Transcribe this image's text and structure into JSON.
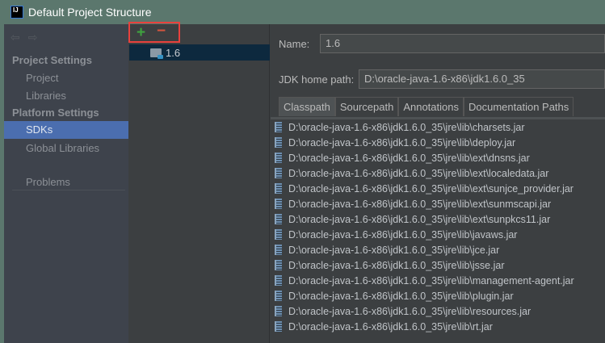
{
  "window": {
    "title": "Default Project Structure",
    "icon": "intellij-icon",
    "icon_text": "IJ"
  },
  "sidebar": {
    "nav": [
      "back-arrow-icon",
      "forward-arrow-icon"
    ],
    "sections": [
      {
        "label": "Project Settings"
      },
      {
        "label": "Platform Settings"
      }
    ],
    "items": [
      {
        "label": "Project"
      },
      {
        "label": "Libraries"
      },
      {
        "label": "SDKs",
        "selected": true
      },
      {
        "label": "Global Libraries"
      },
      {
        "label": "Problems"
      }
    ]
  },
  "toolbar": {
    "add": "+",
    "remove": "−",
    "highlight_color": "#e8413d"
  },
  "sdk_list": [
    {
      "label": "1.6"
    }
  ],
  "details": {
    "name_label": "Name:",
    "name_value": "1.6",
    "home_label": "JDK home path:",
    "home_value": "D:\\oracle-java-1.6-x86\\jdk1.6.0_35",
    "tabs": [
      {
        "label": "Classpath",
        "active": true
      },
      {
        "label": "Sourcepath"
      },
      {
        "label": "Annotations"
      },
      {
        "label": "Documentation Paths"
      }
    ],
    "classpath": [
      "D:\\oracle-java-1.6-x86\\jdk1.6.0_35\\jre\\lib\\charsets.jar",
      "D:\\oracle-java-1.6-x86\\jdk1.6.0_35\\jre\\lib\\deploy.jar",
      "D:\\oracle-java-1.6-x86\\jdk1.6.0_35\\jre\\lib\\ext\\dnsns.jar",
      "D:\\oracle-java-1.6-x86\\jdk1.6.0_35\\jre\\lib\\ext\\localedata.jar",
      "D:\\oracle-java-1.6-x86\\jdk1.6.0_35\\jre\\lib\\ext\\sunjce_provider.jar",
      "D:\\oracle-java-1.6-x86\\jdk1.6.0_35\\jre\\lib\\ext\\sunmscapi.jar",
      "D:\\oracle-java-1.6-x86\\jdk1.6.0_35\\jre\\lib\\ext\\sunpkcs11.jar",
      "D:\\oracle-java-1.6-x86\\jdk1.6.0_35\\jre\\lib\\javaws.jar",
      "D:\\oracle-java-1.6-x86\\jdk1.6.0_35\\jre\\lib\\jce.jar",
      "D:\\oracle-java-1.6-x86\\jdk1.6.0_35\\jre\\lib\\jsse.jar",
      "D:\\oracle-java-1.6-x86\\jdk1.6.0_35\\jre\\lib\\management-agent.jar",
      "D:\\oracle-java-1.6-x86\\jdk1.6.0_35\\jre\\lib\\plugin.jar",
      "D:\\oracle-java-1.6-x86\\jdk1.6.0_35\\jre\\lib\\resources.jar",
      "D:\\oracle-java-1.6-x86\\jdk1.6.0_35\\jre\\lib\\rt.jar"
    ]
  }
}
